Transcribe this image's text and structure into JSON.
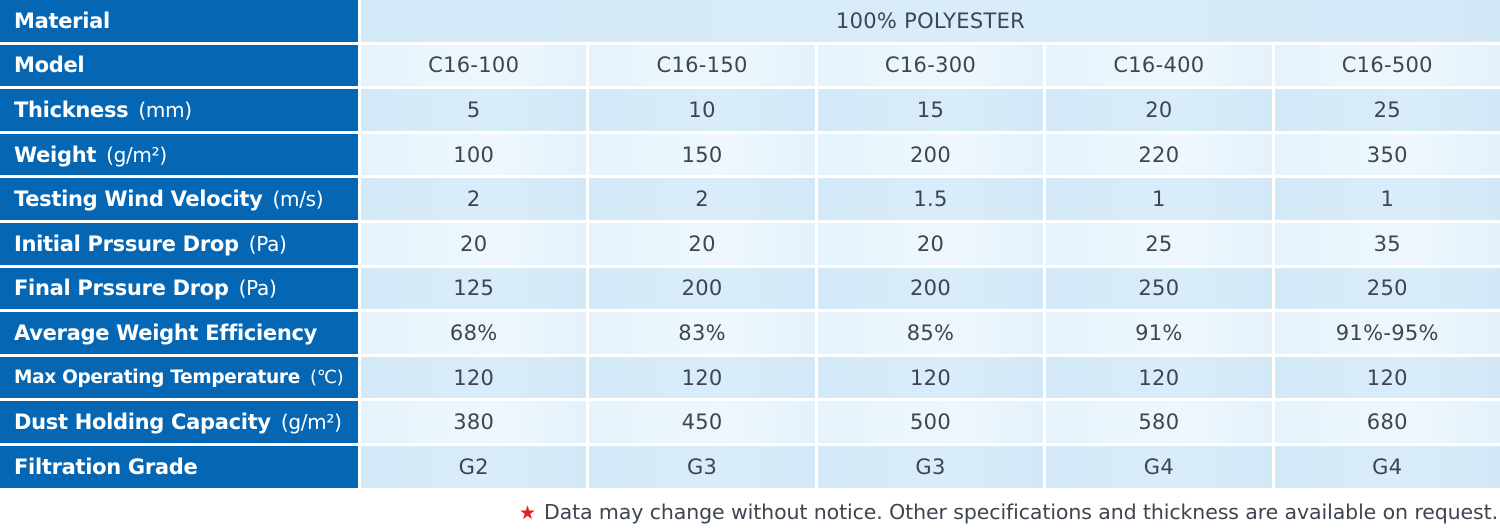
{
  "table": {
    "material": {
      "label": "Material",
      "unit": "",
      "value": "100% POLYESTER"
    },
    "model": {
      "label": "Model",
      "unit": "",
      "values": [
        "C16-100",
        "C16-150",
        "C16-300",
        "C16-400",
        "C16-500"
      ]
    },
    "rows": [
      {
        "label": "Thickness",
        "unit": "(mm)",
        "values": [
          "5",
          "10",
          "15",
          "20",
          "25"
        ]
      },
      {
        "label": "Weight",
        "unit": "(g/m²)",
        "values": [
          "100",
          "150",
          "200",
          "220",
          "350"
        ]
      },
      {
        "label": "Testing Wind Velocity",
        "unit": "(m/s)",
        "values": [
          "2",
          "2",
          "1.5",
          "1",
          "1"
        ]
      },
      {
        "label": "Initial Prssure Drop",
        "unit": "(Pa)",
        "values": [
          "20",
          "20",
          "20",
          "25",
          "35"
        ]
      },
      {
        "label": "Final Prssure Drop",
        "unit": "(Pa)",
        "values": [
          "125",
          "200",
          "200",
          "250",
          "250"
        ]
      },
      {
        "label": "Average Weight Efficiency",
        "unit": "",
        "values": [
          "68%",
          "83%",
          "85%",
          "91%",
          "91%-95%"
        ]
      },
      {
        "label": "Max Operating Temperature",
        "unit": "(℃)",
        "values": [
          "120",
          "120",
          "120",
          "120",
          "120"
        ]
      },
      {
        "label": "Dust Holding Capacity",
        "unit": "(g/m²)",
        "values": [
          "380",
          "450",
          "500",
          "580",
          "680"
        ]
      },
      {
        "label": "Filtration Grade",
        "unit": "",
        "values": [
          "G2",
          "G3",
          "G3",
          "G4",
          "G4"
        ]
      }
    ]
  },
  "footnote": {
    "icon": "star-icon",
    "star": "★",
    "text": "Data may change without notice. Other specifications and thickness are available on request."
  },
  "colors": {
    "header_bg": "#0567b4",
    "header_text": "#ffffff",
    "cell_text": "#3d4650",
    "star": "#e41f1f"
  }
}
